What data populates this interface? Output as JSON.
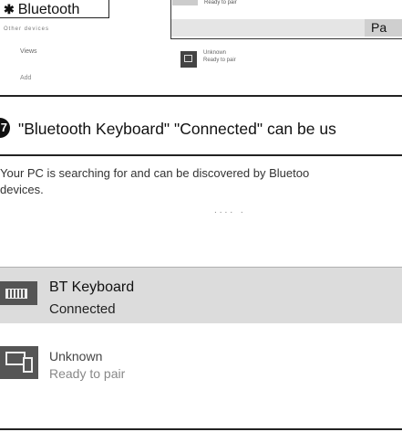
{
  "top_screenshot": {
    "bluetooth_button_label": "Bluetooth",
    "bluetooth_glyph": "✱",
    "left_faint_row": "Other devices",
    "left_item_1": "Views",
    "left_item_2": "Add",
    "top_device_status": "Ready to pair",
    "pair_button_label": "Pa",
    "bottom_device_name": "Unknown",
    "bottom_device_status": "Ready to pair"
  },
  "instruction": {
    "step_number": "7",
    "text": "\"Bluetooth Keyboard\" \"Connected\" can be us"
  },
  "bottom_screenshot": {
    "scan_line_1": "Your PC is searching for and can be discovered by Bluetoo",
    "scan_line_2": "devices.",
    "searching_dots": "....  .",
    "devices": [
      {
        "name": "BT Keyboard",
        "status": "Connected",
        "icon": "keyboard-icon"
      },
      {
        "name": "Unknown",
        "status": "Ready to pair",
        "icon": "device-icon"
      }
    ]
  },
  "colors": {
    "selected_row_bg": "#dcdcdc",
    "icon_bg": "#555555"
  }
}
